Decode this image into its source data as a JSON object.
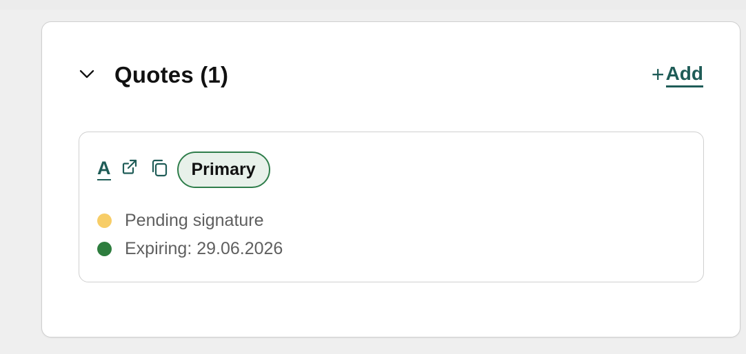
{
  "section": {
    "title": "Quotes (1)",
    "add_plus": "+",
    "add_label": "Add"
  },
  "quote": {
    "name": "A",
    "badge": "Primary",
    "statuses": [
      {
        "text": "Pending signature",
        "color": "#f7cd67"
      },
      {
        "text": "Expiring: 29.06.2026",
        "color": "#2e7d3e"
      }
    ]
  },
  "colors": {
    "accent": "#1f5c57",
    "badge_border": "#2e7d4a",
    "badge_bg": "#e8f1ea"
  },
  "icons": {
    "collapse": "chevron-down-icon",
    "external": "external-link-icon",
    "copy": "copy-icon"
  }
}
